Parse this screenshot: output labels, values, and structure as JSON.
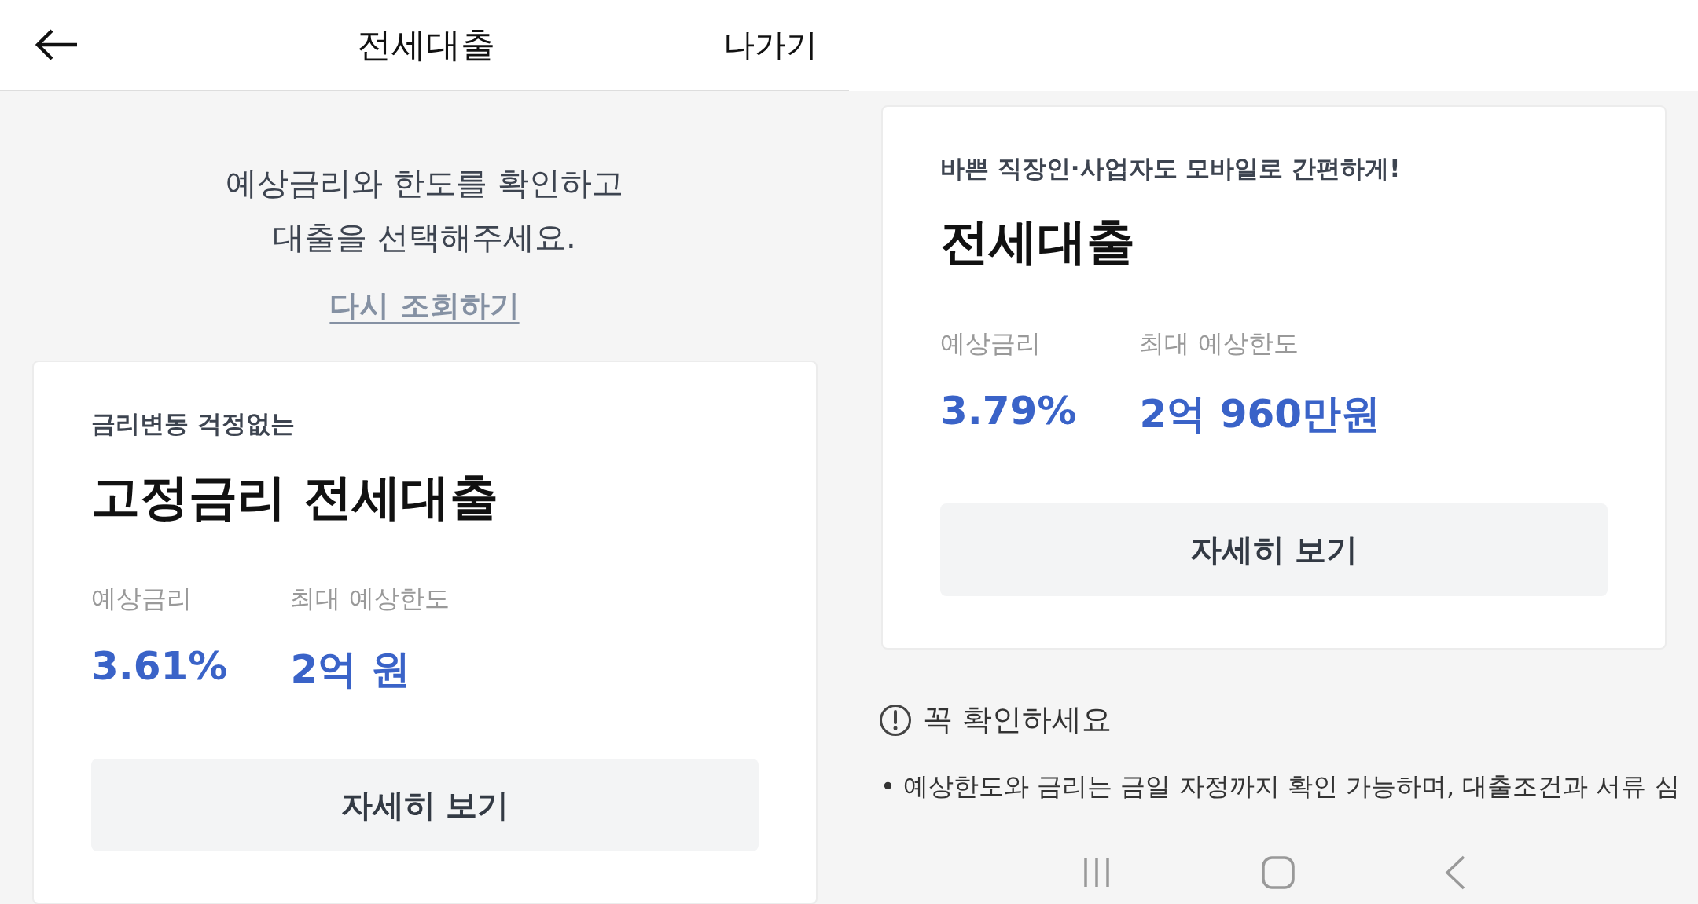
{
  "left_screen": {
    "header": {
      "title": "전세대출",
      "exit": "나가기"
    },
    "intro": [
      "예상금리와 한도를 확인하고",
      "대출을 선택해주세요."
    ],
    "refresh_link": "다시 조회하기",
    "card": {
      "subtitle": "금리변동 걱정없는",
      "title": "고정금리 전세대출",
      "metrics": [
        {
          "label": "예상금리",
          "value": "3.61%"
        },
        {
          "label": "최대 예상한도",
          "value": "2억 원"
        }
      ],
      "button": "자세히 보기"
    }
  },
  "right_screen": {
    "card": {
      "subtitle": "바쁜 직장인·사업자도 모바일로 간편하게!",
      "title": "전세대출",
      "metrics": [
        {
          "label": "예상금리",
          "value": "3.79%"
        },
        {
          "label": "최대 예상한도",
          "value": "2억 960만원"
        }
      ],
      "button": "자세히 보기"
    },
    "notice": {
      "title": "꼭 확인하세요",
      "bullets": [
        "• 예상한도와 금리는 금일 자정까지 확인 가능하며, 대출조건과 서류 심"
      ]
    }
  }
}
